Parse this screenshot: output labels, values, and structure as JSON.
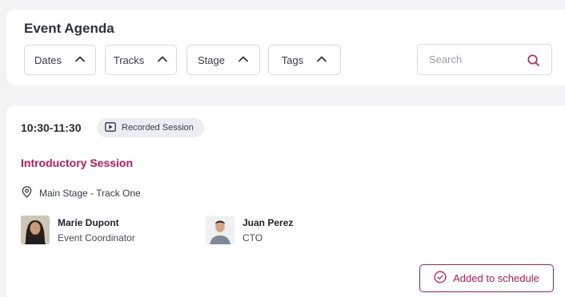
{
  "header": {
    "title": "Event Agenda",
    "filters": [
      {
        "label": "Dates",
        "icon": "chevron-up-icon"
      },
      {
        "label": "Tracks",
        "icon": "chevron-up-icon"
      },
      {
        "label": "Stage",
        "icon": "chevron-up-icon"
      },
      {
        "label": "Tags",
        "icon": "chevron-up-icon"
      }
    ],
    "search": {
      "placeholder": "Search",
      "icon": "search-icon"
    }
  },
  "session": {
    "time": "10:30-11:30",
    "badge": {
      "label": "Recorded Session",
      "icon": "play-icon"
    },
    "title": "Introductory Session",
    "location": {
      "label": "Main Stage - Track One",
      "icon": "location-pin-icon"
    },
    "speakers": [
      {
        "name": "Marie Dupont",
        "role": "Event Coordinator"
      },
      {
        "name": "Juan Perez",
        "role": "CTO"
      }
    ],
    "action": {
      "label": "Added to schedule",
      "icon": "check-circle-icon"
    }
  },
  "colors": {
    "accent": "#c2185b",
    "page_background": "#f3f3f5",
    "badge_background": "#ececf3"
  }
}
